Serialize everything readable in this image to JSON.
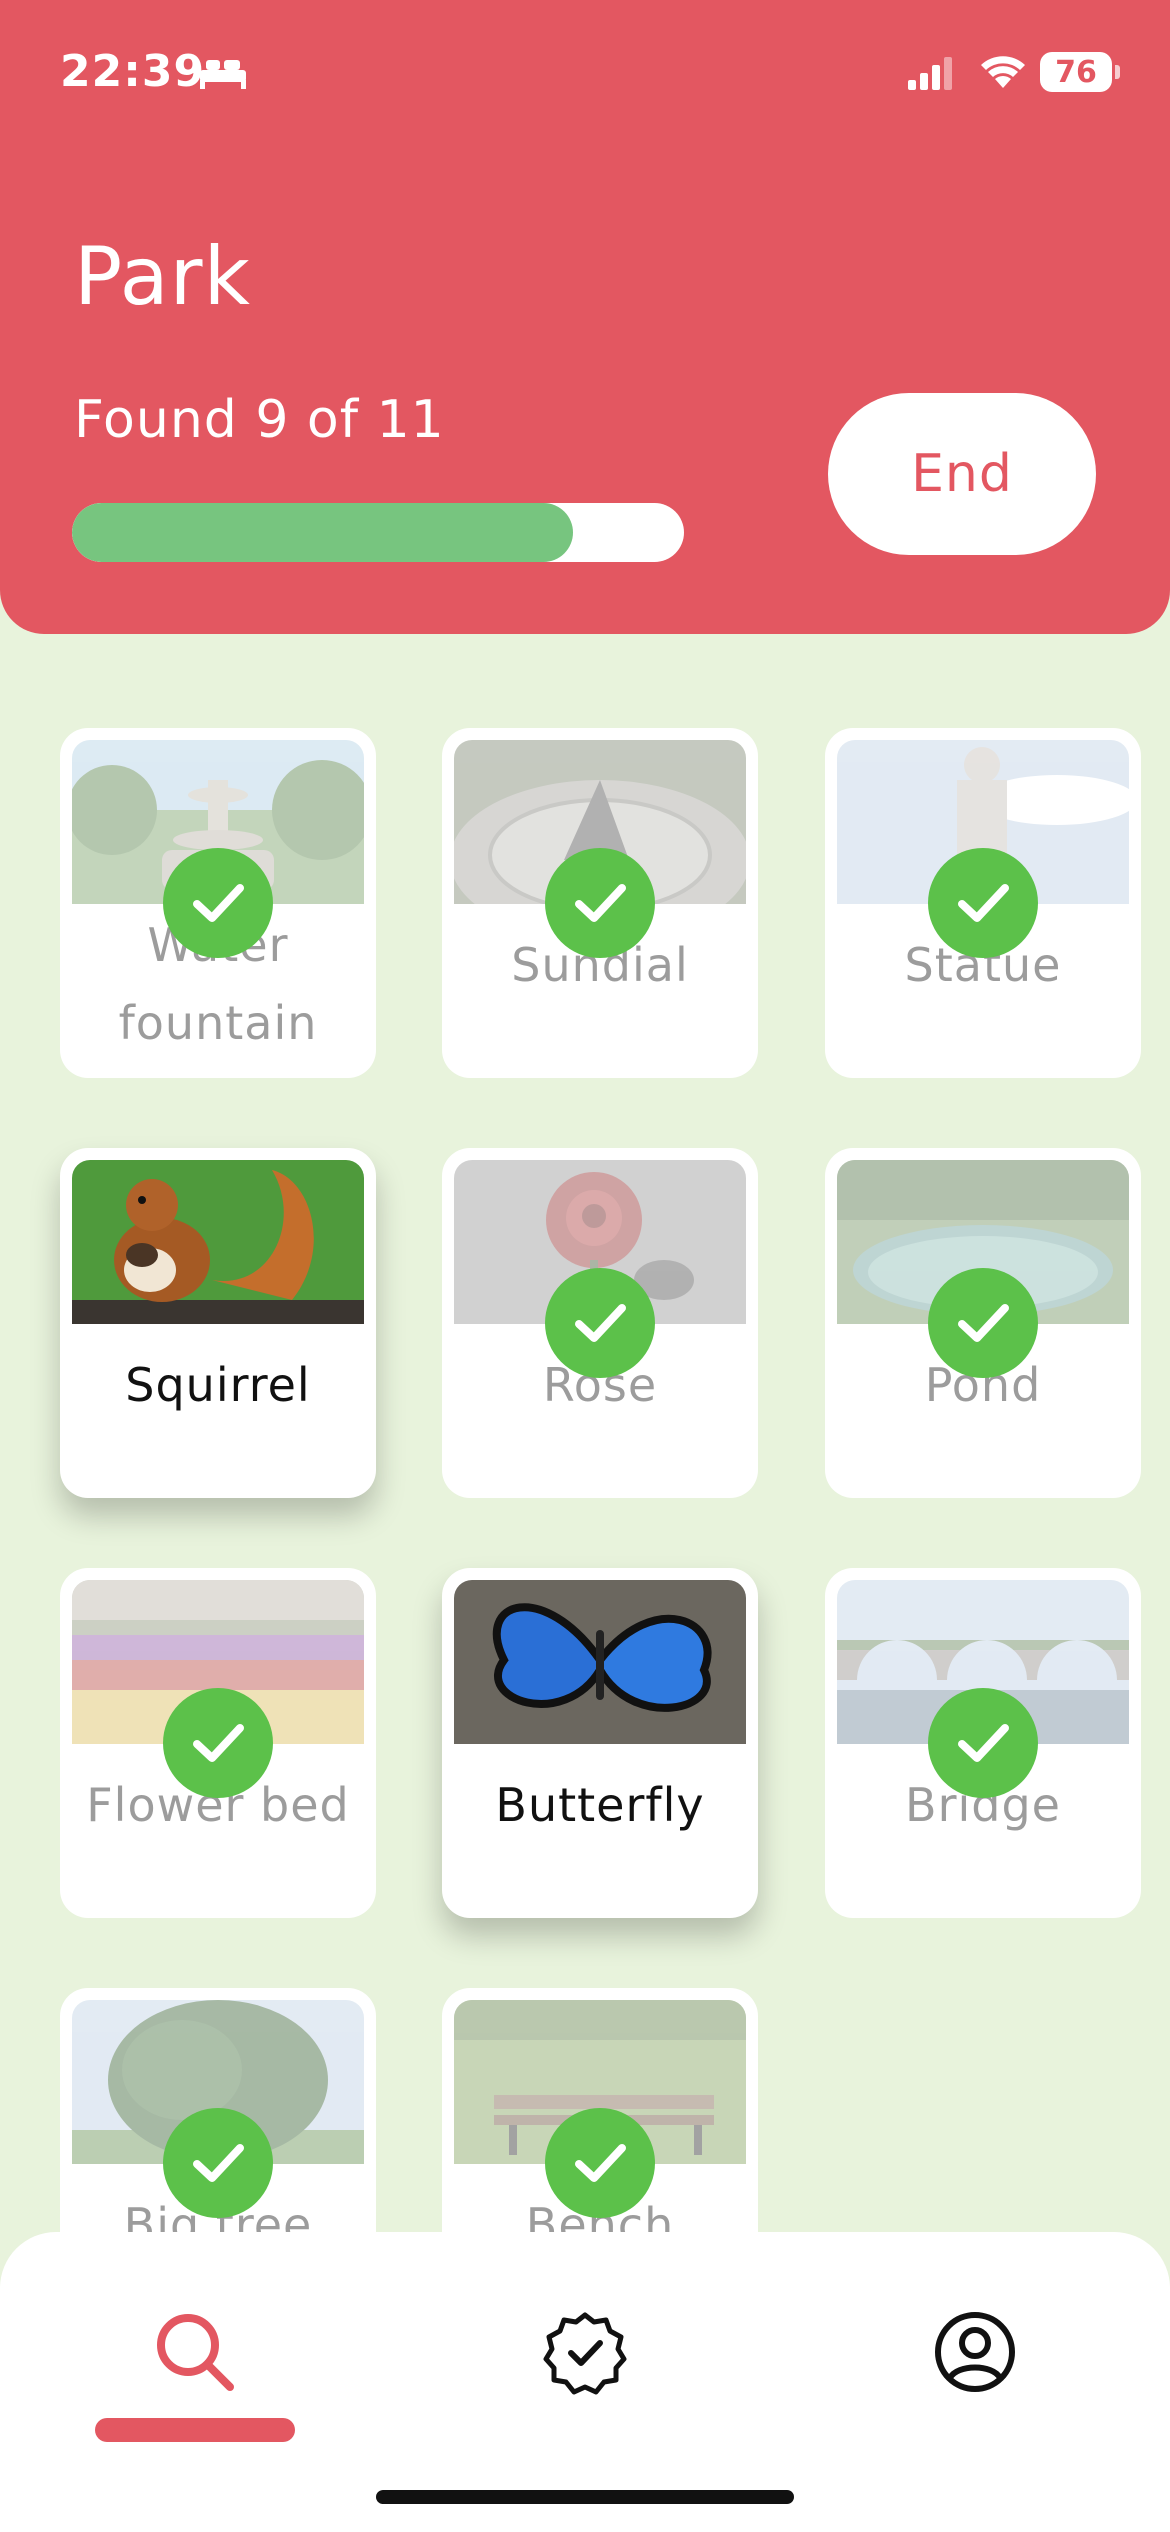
{
  "status_bar": {
    "time": "22:39",
    "battery": "76"
  },
  "header": {
    "title": "Park",
    "progress_text": "Found 9 of 11",
    "progress": {
      "found": 9,
      "total": 11,
      "fraction": 0.818
    },
    "end_label": "End"
  },
  "items": [
    {
      "label": "Water fountain",
      "found": true,
      "image": "water-fountain"
    },
    {
      "label": "Sundial",
      "found": true,
      "image": "sundial"
    },
    {
      "label": "Statue",
      "found": true,
      "image": "statue"
    },
    {
      "label": "Squirrel",
      "found": false,
      "image": "squirrel"
    },
    {
      "label": "Rose",
      "found": true,
      "image": "rose"
    },
    {
      "label": "Pond",
      "found": true,
      "image": "pond"
    },
    {
      "label": "Flower bed",
      "found": true,
      "image": "flower-bed"
    },
    {
      "label": "Butterfly",
      "found": false,
      "image": "butterfly"
    },
    {
      "label": "Bridge",
      "found": true,
      "image": "bridge"
    },
    {
      "label": "Big tree",
      "found": true,
      "image": "big-tree"
    },
    {
      "label": "Bench",
      "found": true,
      "image": "bench"
    }
  ],
  "bottom_nav": [
    {
      "icon": "search-icon",
      "active": true
    },
    {
      "icon": "badge-check-icon",
      "active": false
    },
    {
      "icon": "user-profile-icon",
      "active": false
    }
  ],
  "colors": {
    "header": "#e35761",
    "background": "#e8f3dc",
    "progress_fill": "#77c57f",
    "check": "#5cc14a"
  }
}
